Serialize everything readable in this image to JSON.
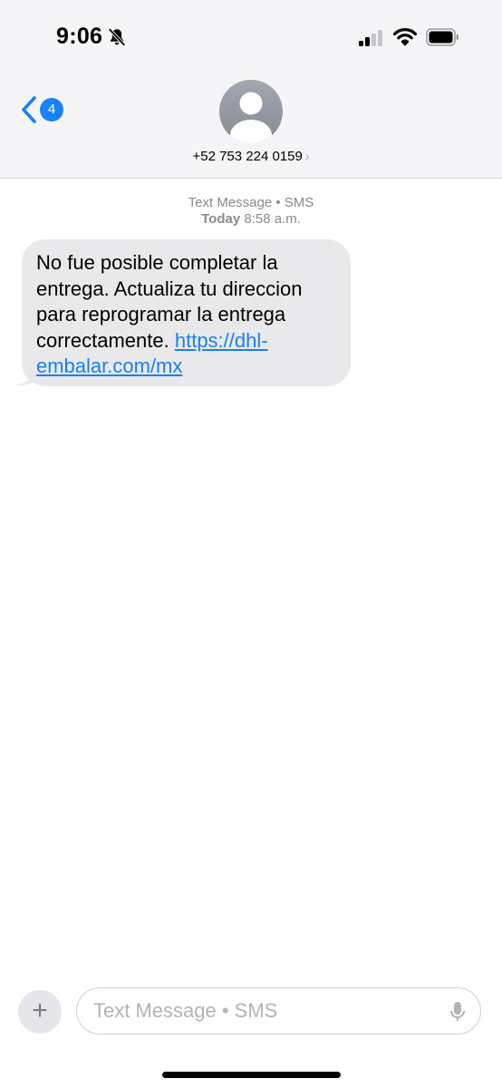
{
  "status_bar": {
    "time": "9:06"
  },
  "header": {
    "back_badge": "4",
    "contact_number": "+52 753 224 0159",
    "contact_chevron": "›"
  },
  "conversation": {
    "service_label": "Text Message • SMS",
    "day": "Today",
    "time": "8:58 a.m.",
    "message_text": "No fue posible completar la entrega. Actualiza tu direccion para reprogramar la entrega correctamente.",
    "message_link_part1": "https://dhl-",
    "message_link_part2": "embalar.com/mx"
  },
  "composer": {
    "placeholder": "Text Message • SMS",
    "plus": "+"
  },
  "colors": {
    "accent": "#1a82f7",
    "bubble": "#e9e9eb",
    "header_bg": "#f5f5f7"
  },
  "icons": [
    "bell-slash-icon",
    "cellular-signal-icon",
    "wifi-icon",
    "battery-icon",
    "chevron-left-icon",
    "person-icon",
    "plus-icon",
    "microphone-icon"
  ]
}
